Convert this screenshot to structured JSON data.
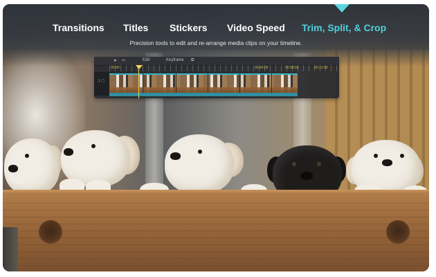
{
  "nav": {
    "tabs": [
      {
        "label": "Transitions",
        "active": false
      },
      {
        "label": "Titles",
        "active": false
      },
      {
        "label": "Stickers",
        "active": false
      },
      {
        "label": "Video Speed",
        "active": false
      },
      {
        "label": "Trim, Split, & Crop",
        "active": true
      }
    ],
    "subtitle": "Precision tools to edit and re-arrange media clips on your timeline.",
    "accent_color": "#4fd1dc",
    "active_indicator_color": "#5ad5e2"
  },
  "timeline": {
    "toolbar": {
      "tools": [
        {
          "icon": "cursor-arrow-icon",
          "label": ""
        },
        {
          "icon": "scissors-icon",
          "label": ""
        },
        {
          "icon": "",
          "label": "Edit"
        },
        {
          "icon": "",
          "label": "Keyframe"
        },
        {
          "icon": "crop-icon",
          "label": ""
        }
      ]
    },
    "ruler_labels": [
      "00:00",
      "00:04:00",
      "00:08:00",
      "00:12:00"
    ],
    "track_label": "1 ▢",
    "clip_color": "#2f8fa0",
    "playhead_color": "#f3d65a"
  },
  "scene": {
    "puppies": [
      "white",
      "white",
      "white",
      "black",
      "white"
    ]
  }
}
